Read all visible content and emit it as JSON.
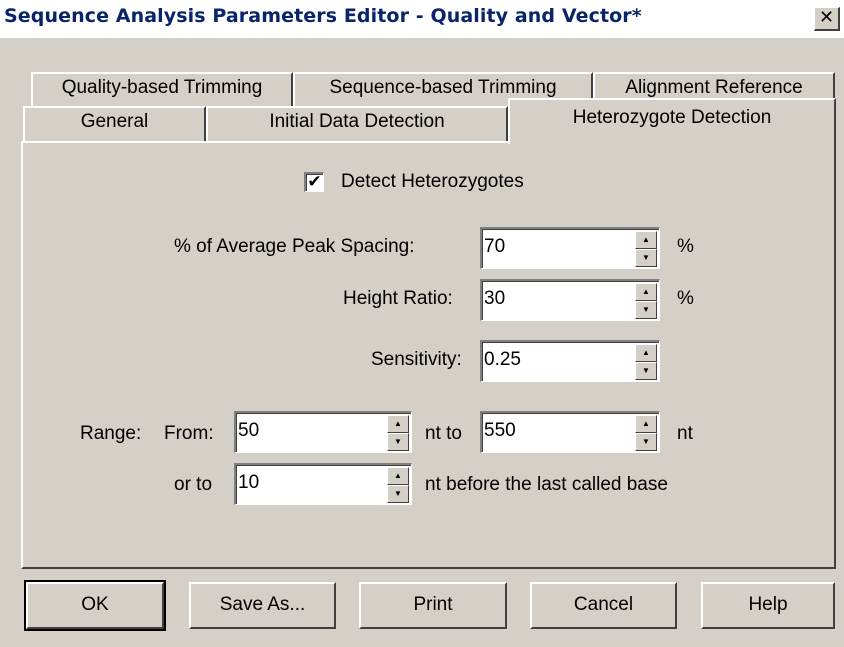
{
  "window": {
    "title": "Sequence Analysis Parameters Editor - Quality and Vector*",
    "close_label": "✕"
  },
  "tabs": {
    "row_back": [
      "Quality-based Trimming",
      "Sequence-based Trimming",
      "Alignment Reference"
    ],
    "row_front": [
      "General",
      "Initial Data Detection",
      "Heterozygote Detection"
    ],
    "active": "Heterozygote Detection"
  },
  "heterozygote": {
    "detect_label": "Detect Heterozygotes",
    "detect_checked": true,
    "check_glyph": "✔",
    "peak_spacing_label": "% of Average Peak Spacing:",
    "peak_spacing_value": "70",
    "peak_spacing_unit": "%",
    "height_ratio_label": "Height Ratio:",
    "height_ratio_value": "30",
    "height_ratio_unit": "%",
    "sensitivity_label": "Sensitivity:",
    "sensitivity_value": "0.25",
    "range_label": "Range:",
    "from_label": "From:",
    "from_value": "50",
    "nt_to_label": "nt to",
    "to_value": "550",
    "nt_unit": "nt",
    "or_to_label": "or to",
    "or_to_value": "10",
    "before_last_label": "nt before the last called base"
  },
  "spin": {
    "up_glyph": "▲",
    "down_glyph": "▼"
  },
  "buttons": {
    "ok": "OK",
    "save_as": "Save As...",
    "print": "Print",
    "cancel": "Cancel",
    "help": "Help"
  }
}
